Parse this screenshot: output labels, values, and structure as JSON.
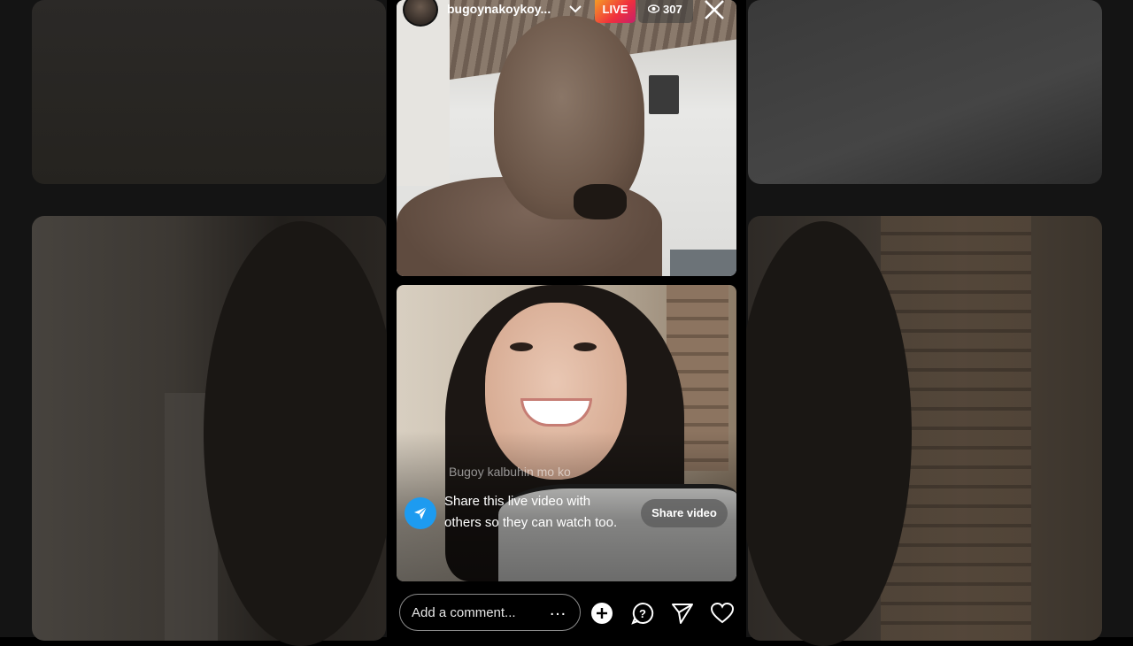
{
  "header": {
    "username": "bugoynakoykoy...",
    "live_label": "LIVE",
    "viewer_count": "307"
  },
  "comments": {
    "faded_comment": "Bugoy kalbuhin mo ko"
  },
  "share_prompt": {
    "text": "Share this live video with others so they can watch too.",
    "button_label": "Share video"
  },
  "composer": {
    "placeholder": "Add a comment...",
    "more_label": "…"
  },
  "icons": {
    "close": "close-icon",
    "chevron": "chevron-down-icon",
    "eye": "eye-icon",
    "share": "paper-plane-icon",
    "add": "plus-circle-icon",
    "question": "question-bubble-icon",
    "send": "send-icon",
    "like": "heart-icon"
  },
  "colors": {
    "live_gradient_start": "#f5a623",
    "live_gradient_end": "#c5206b",
    "share_icon_bg": "#1d9bf0"
  }
}
